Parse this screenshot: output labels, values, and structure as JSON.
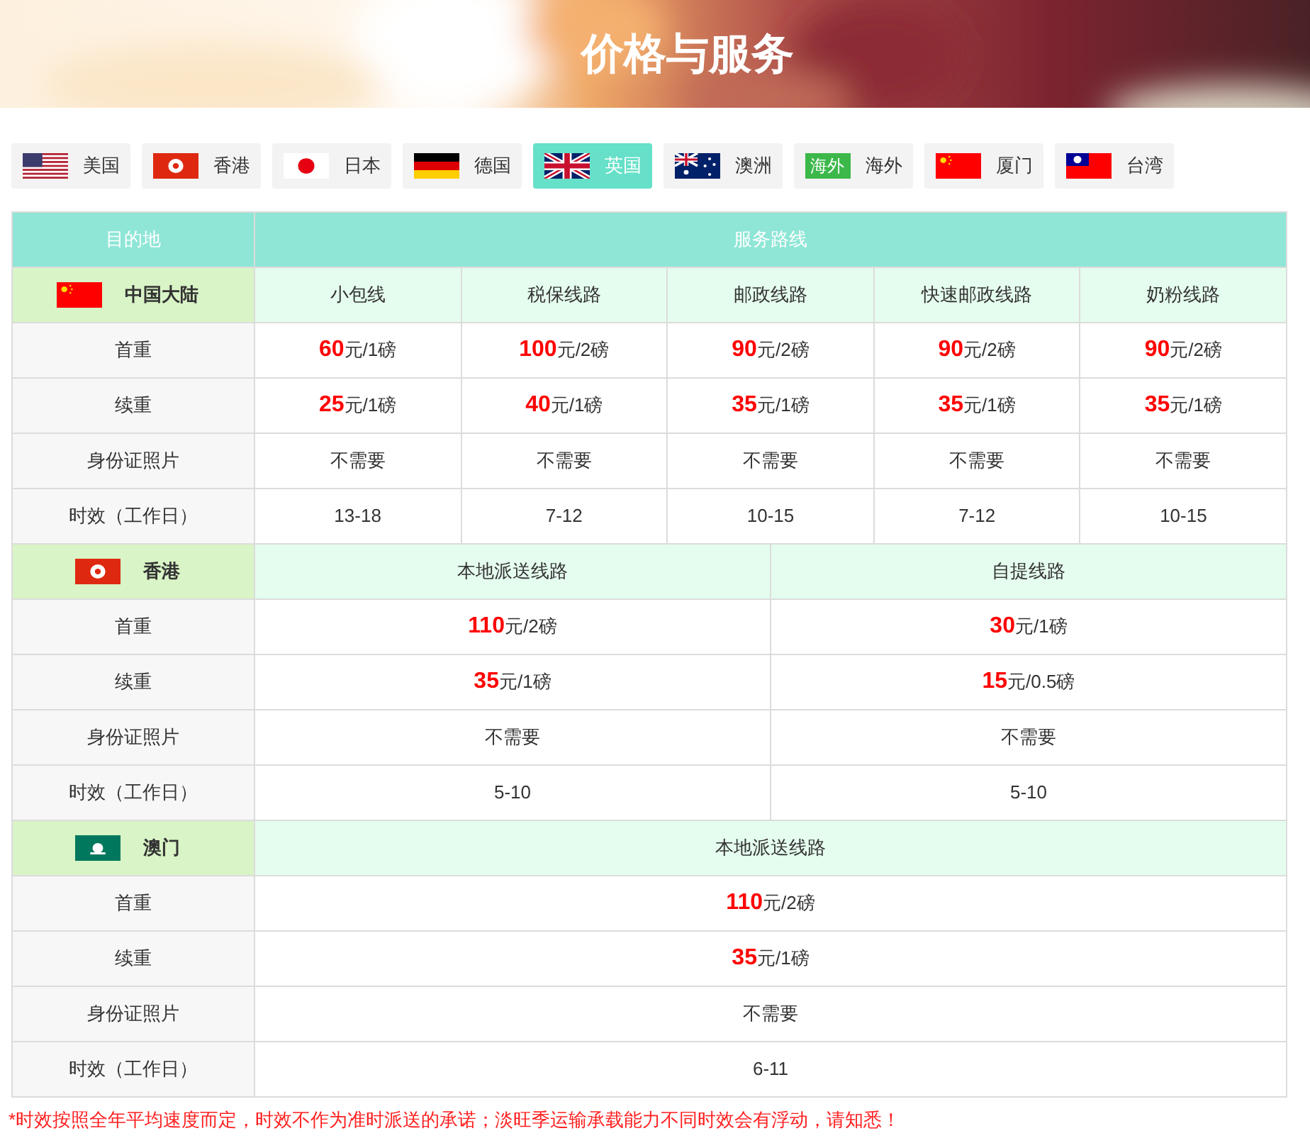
{
  "banner": {
    "title": "价格与服务"
  },
  "tabs": [
    {
      "kind": "us",
      "label": "美国",
      "selected": false
    },
    {
      "kind": "hk",
      "label": "香港",
      "selected": false
    },
    {
      "kind": "jp",
      "label": "日本",
      "selected": false
    },
    {
      "kind": "de",
      "label": "德国",
      "selected": false
    },
    {
      "kind": "gb",
      "label": "英国",
      "selected": true
    },
    {
      "kind": "au",
      "label": "澳洲",
      "selected": false
    },
    {
      "kind": "badge",
      "badge": "海外",
      "label": "海外",
      "selected": false
    },
    {
      "kind": "cn",
      "label": "厦门",
      "selected": false
    },
    {
      "kind": "tw",
      "label": "台湾",
      "selected": false
    }
  ],
  "table": {
    "columns": [
      "目的地",
      "服务路线"
    ],
    "sections": [
      {
        "kind": "cn",
        "region": "中国大陆",
        "routes": [
          "小包线",
          "税保线路",
          "邮政线路",
          "快速邮政线路",
          "奶粉线路"
        ],
        "rows": [
          {
            "kind": "price",
            "label": "首重",
            "cells": [
              {
                "amount": "60",
                "unit": "元/1磅"
              },
              {
                "amount": "100",
                "unit": "元/2磅"
              },
              {
                "amount": "90",
                "unit": "元/2磅"
              },
              {
                "amount": "90",
                "unit": "元/2磅"
              },
              {
                "amount": "90",
                "unit": "元/2磅"
              }
            ]
          },
          {
            "kind": "price",
            "label": "续重",
            "cells": [
              {
                "amount": "25",
                "unit": "元/1磅"
              },
              {
                "amount": "40",
                "unit": "元/1磅"
              },
              {
                "amount": "35",
                "unit": "元/1磅"
              },
              {
                "amount": "35",
                "unit": "元/1磅"
              },
              {
                "amount": "35",
                "unit": "元/1磅"
              }
            ]
          },
          {
            "kind": "text",
            "label": "身份证照片",
            "cells": [
              "不需要",
              "不需要",
              "不需要",
              "不需要",
              "不需要"
            ]
          },
          {
            "kind": "text",
            "label": "时效（工作日）",
            "cells": [
              "13-18",
              "7-12",
              "10-15",
              "7-12",
              "10-15"
            ]
          }
        ]
      },
      {
        "kind": "hk",
        "region": "香港",
        "routes": [
          "本地派送线路",
          "自提线路"
        ],
        "rows": [
          {
            "kind": "price",
            "label": "首重",
            "cells": [
              {
                "amount": "110",
                "unit": "元/2磅"
              },
              {
                "amount": "30",
                "unit": "元/1磅"
              }
            ]
          },
          {
            "kind": "price",
            "label": "续重",
            "cells": [
              {
                "amount": "35",
                "unit": "元/1磅"
              },
              {
                "amount": "15",
                "unit": "元/0.5磅"
              }
            ]
          },
          {
            "kind": "text",
            "label": "身份证照片",
            "cells": [
              "不需要",
              "不需要"
            ]
          },
          {
            "kind": "text",
            "label": "时效（工作日）",
            "cells": [
              "5-10",
              "5-10"
            ]
          }
        ]
      },
      {
        "kind": "mo",
        "region": "澳门",
        "routes": [
          "本地派送线路"
        ],
        "rows": [
          {
            "kind": "price",
            "label": "首重",
            "cells": [
              {
                "amount": "110",
                "unit": "元/2磅"
              }
            ]
          },
          {
            "kind": "price",
            "label": "续重",
            "cells": [
              {
                "amount": "35",
                "unit": "元/1磅"
              }
            ]
          },
          {
            "kind": "text",
            "label": "身份证照片",
            "cells": [
              "不需要"
            ]
          },
          {
            "kind": "text",
            "label": "时效（工作日）",
            "cells": [
              "6-11"
            ]
          }
        ]
      }
    ]
  },
  "note": "*时效按照全年平均速度而定，时效不作为准时派送的承诺；淡旺季运输承载能力不同时效会有浮动，请知悉！"
}
